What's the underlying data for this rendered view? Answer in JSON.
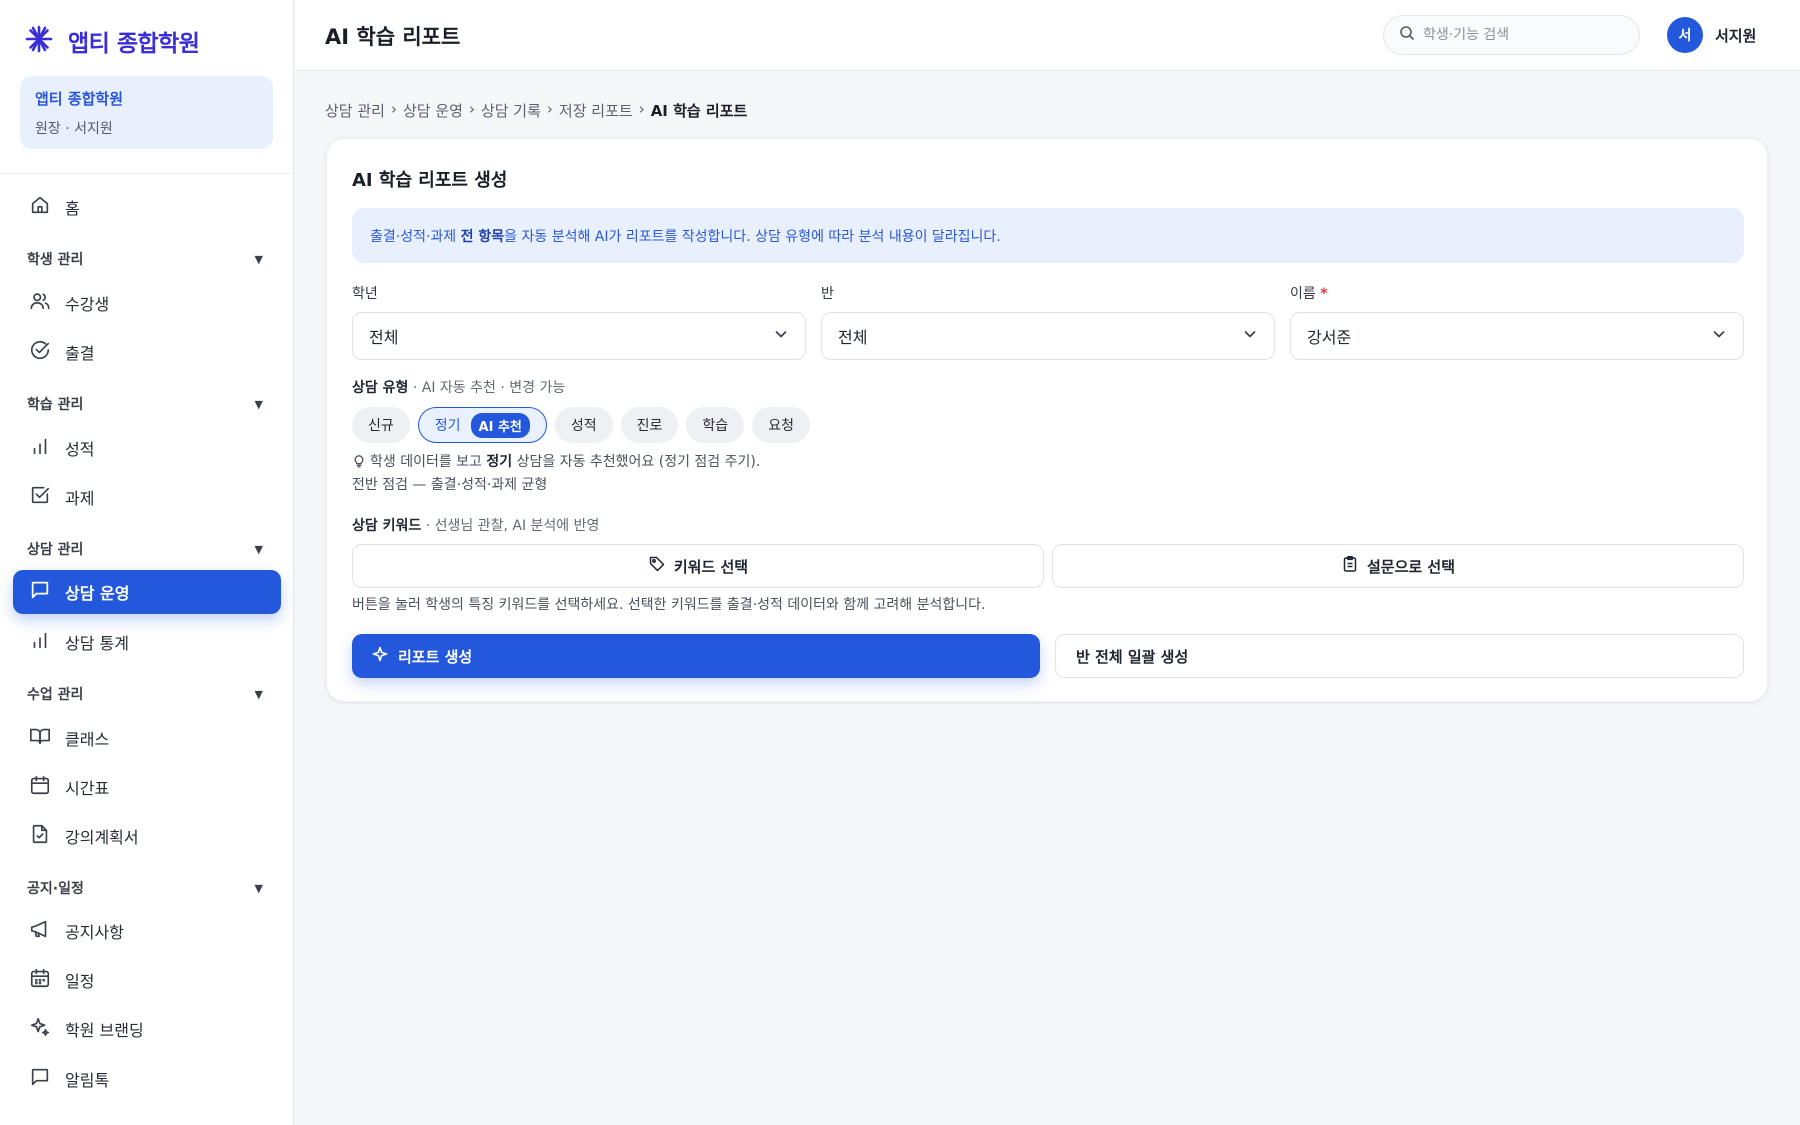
{
  "brand": {
    "name": "앱티 종합학원",
    "accent": "#2458dc",
    "logo_color": "#3a2fd6"
  },
  "academy_card": {
    "name": "앱티 종합학원",
    "role": "원장 · 서지원"
  },
  "nav": {
    "home": "홈",
    "groups": {
      "students": "학생 관리",
      "learning": "학습 관리",
      "counseling": "상담 관리",
      "classes": "수업 관리",
      "notice": "공지·일정"
    },
    "items": {
      "enrolled": "수강생",
      "attendance": "출결",
      "grades": "성적",
      "assignments": "과제",
      "counsel_ops": "상담 운영",
      "counsel_stats": "상담 통계",
      "class": "클래스",
      "timetable": "시간표",
      "syllabus": "강의계획서",
      "announcements": "공지사항",
      "schedule": "일정",
      "branding": "학원 브랜딩",
      "alimtalk": "알림톡"
    }
  },
  "header": {
    "title": "AI 학습 리포트",
    "search_placeholder": "학생·기능 검색",
    "user_initial": "서",
    "user_name": "서지원"
  },
  "breadcrumb": [
    "상담 관리",
    "상담 운영",
    "상담 기록",
    "저장 리포트",
    "AI 학습 리포트"
  ],
  "breadcrumb_sep": "›",
  "card": {
    "title": "AI 학습 리포트 생성",
    "banner_pre": "출결·성적·과제 ",
    "banner_bold": "전 항목",
    "banner_post": "을 자동 분석해 AI가 리포트를 작성합니다. 상담 유형에 따라 분석 내용이 달라집니다.",
    "fields": {
      "grade": {
        "label": "학년",
        "value": "전체"
      },
      "class": {
        "label": "반",
        "value": "전체"
      },
      "name": {
        "label": "이름",
        "required_mark": "*",
        "value": "강서준"
      }
    },
    "type_section": {
      "label": "상담 유형",
      "sub": " · AI 자동 추천 · 변경 가능"
    },
    "chips": [
      "신규",
      "정기",
      "성적",
      "진로",
      "학습",
      "요청"
    ],
    "ai_badge": "AI 추천",
    "hint_pre": "학생 데이터를 보고 ",
    "hint_bold": "정기",
    "hint_post": " 상담을 자동 추천했어요 (정기 점검 주기).",
    "hint_line2": "전반 점검 — 출결·성적·과제 균형",
    "keyword_section": {
      "label": "상담 키워드",
      "sub": " · 선생님 관찰, AI 분석에 반영"
    },
    "keyword_button": "키워드 선택",
    "survey_button": "설문으로 선택",
    "help_text": "버튼을 눌러 학생의 특징 키워드를 선택하세요. 선택한 키워드를 출결·성적 데이터와 함께 고려해 분석합니다.",
    "generate_button": "리포트 생성",
    "bulk_button": "반 전체 일괄 생성"
  }
}
